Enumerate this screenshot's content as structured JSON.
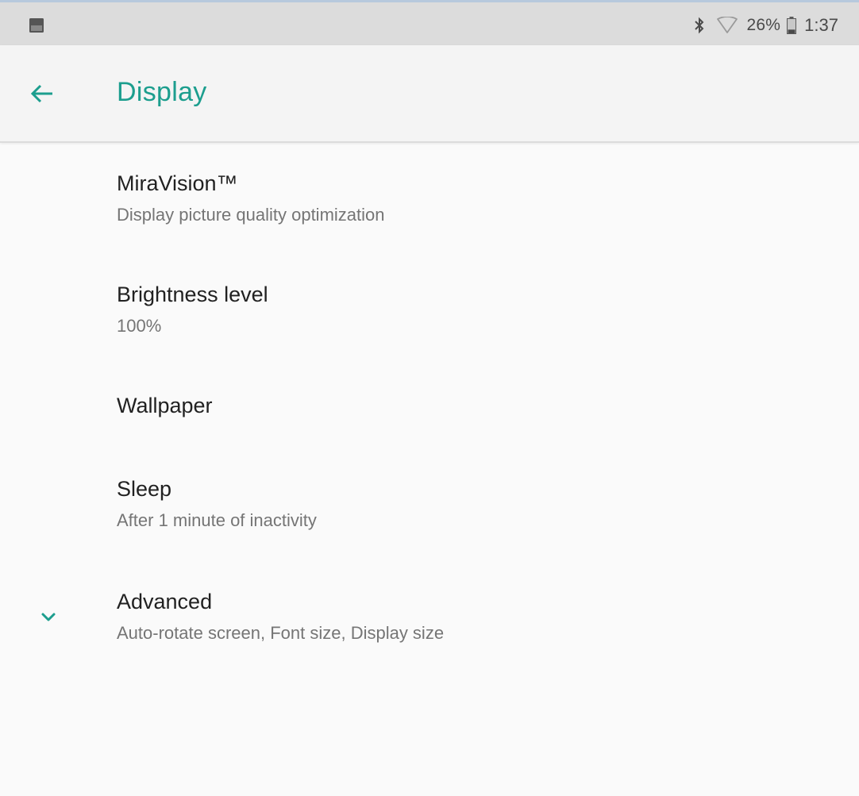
{
  "status_bar": {
    "notification_icon": "image-icon",
    "bluetooth_icon": "bluetooth-icon",
    "wifi_icon": "wifi-icon",
    "battery_percent": "26%",
    "battery_icon": "battery-icon",
    "battery_level": 0.26,
    "time": "1:37"
  },
  "app_bar": {
    "back_icon": "back-arrow-icon",
    "title": "Display"
  },
  "settings": [
    {
      "title": "MiraVision™",
      "summary": "Display picture quality optimization"
    },
    {
      "title": "Brightness level",
      "summary": "100%"
    },
    {
      "title": "Wallpaper",
      "summary": ""
    },
    {
      "title": "Sleep",
      "summary": "After 1 minute of inactivity"
    },
    {
      "title": "Advanced",
      "summary": "Auto-rotate screen, Font size, Display size",
      "icon": "chevron-down-icon"
    }
  ],
  "colors": {
    "accent": "#1c9e8e",
    "status_bar_bg": "#dcdcdc",
    "app_bar_bg": "#f4f4f4",
    "background": "#fafafa",
    "title_text": "#212121",
    "summary_text": "#757575"
  }
}
